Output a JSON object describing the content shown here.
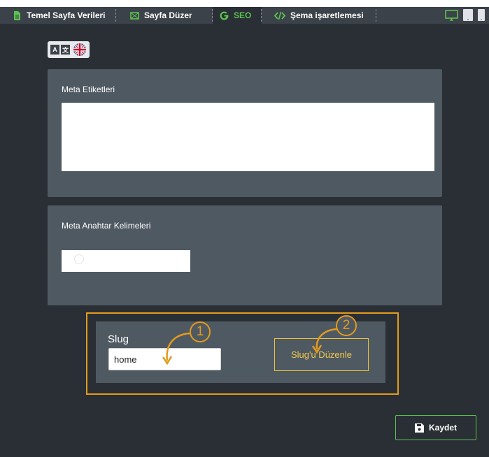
{
  "tabs": [
    {
      "label": "Temel Sayfa Verileri",
      "icon": "document-icon"
    },
    {
      "label": "Sayfa Düzeni",
      "icon": "layout-icon"
    },
    {
      "label": "SEO",
      "icon": "google-g-icon",
      "active": true
    },
    {
      "label": "Şema işaretlemesi",
      "icon": "code-icon"
    }
  ],
  "devices": [
    "desktop-icon",
    "tablet-icon",
    "mobile-icon"
  ],
  "language": {
    "icons": [
      "translate-icon",
      "uk-flag-icon"
    ]
  },
  "meta_tags": {
    "label": "Meta Etiketleri",
    "value": ""
  },
  "meta_keywords": {
    "label": "Meta Anahtar Kelimeleri",
    "value": ""
  },
  "slug": {
    "label": "Slug",
    "value": "home",
    "edit_button": "Slug'u Düzenle"
  },
  "markers": [
    "1",
    "2"
  ],
  "save_button": "Kaydet",
  "colors": {
    "background": "#2a2f35",
    "tabbar": "#3c4249",
    "panel": "#4f5962",
    "active_tab": "#5bc24f",
    "highlight": "#e39a1d",
    "slug_button": "#e9c440",
    "save_border": "#5bc24f"
  }
}
